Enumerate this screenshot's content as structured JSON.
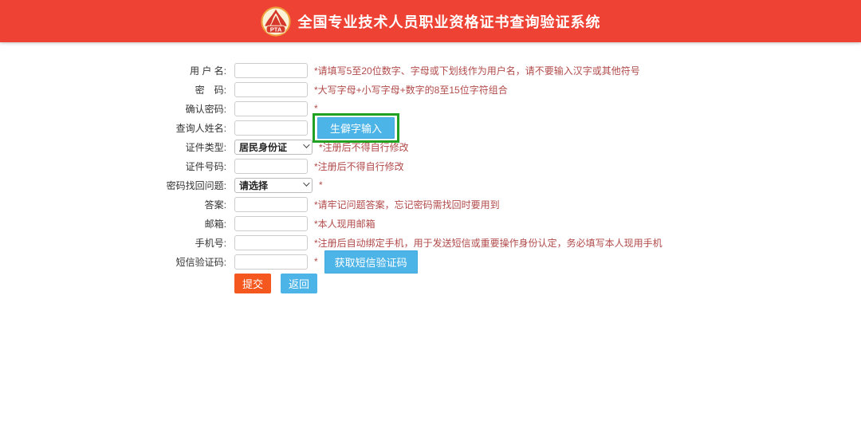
{
  "header": {
    "title": "全国专业技术人员职业资格证书查询验证系统",
    "logo_text": "PTA"
  },
  "form": {
    "rows": [
      {
        "label": "用 户 名:",
        "hint": "*请填写5至20位数字、字母或下划线作为用户名，请不要输入汉字或其他符号"
      },
      {
        "label": "密　码:",
        "hint": "*大写字母+小写字母+数字的8至15位字符组合"
      },
      {
        "label": "确认密码:",
        "hint": "*"
      },
      {
        "label": "查询人姓名:",
        "button": "生僻字输入"
      },
      {
        "label": "证件类型:",
        "value": "居民身份证",
        "hint": "*注册后不得自行修改"
      },
      {
        "label": "证件号码:",
        "hint": "*注册后不得自行修改"
      },
      {
        "label": "密码找回问题:",
        "value": "请选择",
        "hint": "*"
      },
      {
        "label": "答案:",
        "hint": "*请牢记问题答案，忘记密码需找回时要用到"
      },
      {
        "label": "邮箱:",
        "hint": "*本人现用邮箱"
      },
      {
        "label": "手机号:",
        "hint": "*注册后自动绑定手机，用于发送短信或重要操作身份认定，务必填写本人现用手机"
      },
      {
        "label": "短信验证码:",
        "hint": "*",
        "button": "获取短信验证码"
      }
    ],
    "submit_label": "提交",
    "back_label": "返回"
  },
  "colors": {
    "header_bg": "#ee4234",
    "accent_blue": "#4db4e7",
    "submit_orange": "#f4581f",
    "highlight_green": "#21a121",
    "hint_red": "#b14a4a",
    "logo_red": "#d6392c",
    "logo_gold": "#eda13d"
  }
}
